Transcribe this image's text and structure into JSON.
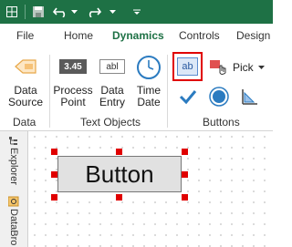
{
  "qat": {
    "icons": [
      "grid-icon",
      "save-icon",
      "undo-icon",
      "redo-icon",
      "customize-icon"
    ]
  },
  "tabs": [
    {
      "label": "File"
    },
    {
      "label": "Home"
    },
    {
      "label": "Dynamics",
      "active": true
    },
    {
      "label": "Controls"
    },
    {
      "label": "Design"
    }
  ],
  "ribbon": {
    "data_source": {
      "line1": "Data",
      "line2": "Source"
    },
    "process_point": {
      "icon_text": "3.45",
      "line1": "Process",
      "line2": "Point"
    },
    "data_entry": {
      "icon_text": "abl",
      "line1": "Data",
      "line2": "Entry"
    },
    "time_date": {
      "line1": "Time",
      "line2": "Date"
    },
    "button_icon_text": "ab",
    "pick_label": "Pick",
    "groups": {
      "data": "Data",
      "text_objects": "Text Objects",
      "buttons": "Buttons"
    }
  },
  "side_panels": {
    "explorer": "Explorer",
    "databrowser": "DataBro"
  },
  "canvas": {
    "button_label": "Button"
  },
  "colors": {
    "accent": "#1e7145",
    "highlight": "#e00000",
    "handle": "#e00000"
  }
}
